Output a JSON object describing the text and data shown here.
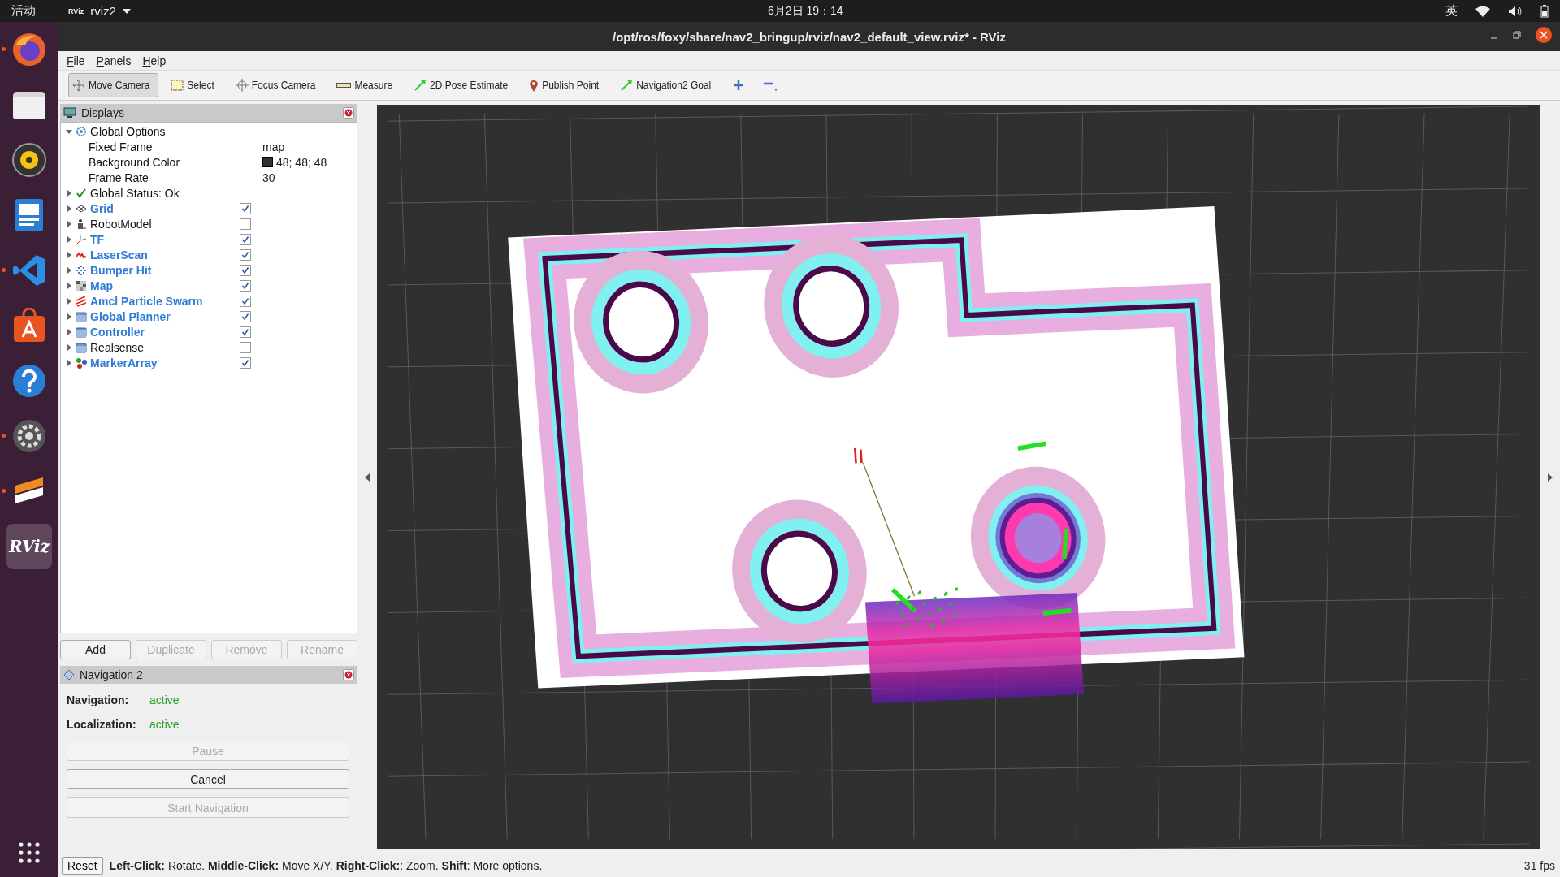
{
  "top_bar": {
    "activities": "活动",
    "app": {
      "logo": "RViz",
      "name": "rviz2"
    },
    "clock": "6月2日 19：14",
    "input_method": "英"
  },
  "window": {
    "title": "/opt/ros/foxy/share/nav2_bringup/rviz/nav2_default_view.rviz* - RViz"
  },
  "dock": [
    {
      "kind": "browser",
      "running": true,
      "selected": false
    },
    {
      "kind": "files",
      "running": false,
      "selected": false
    },
    {
      "kind": "music",
      "running": false,
      "selected": false
    },
    {
      "kind": "document",
      "running": false,
      "selected": false
    },
    {
      "kind": "code",
      "running": true,
      "selected": false
    },
    {
      "kind": "store",
      "running": false,
      "selected": false
    },
    {
      "kind": "help",
      "running": false,
      "selected": false
    },
    {
      "kind": "settings",
      "running": true,
      "selected": false
    },
    {
      "kind": "editor",
      "running": true,
      "selected": false
    },
    {
      "kind": "rviz",
      "label": "RViz",
      "running": false,
      "selected": true
    }
  ],
  "menu": [
    "File",
    "Panels",
    "Help"
  ],
  "toolbar": {
    "tools": [
      {
        "kind": "move",
        "label": "Move Camera",
        "selected": true
      },
      {
        "kind": "select",
        "label": "Select",
        "selected": false
      },
      {
        "kind": "focus",
        "label": "Focus Camera",
        "selected": false
      },
      {
        "kind": "measure",
        "label": "Measure",
        "selected": false
      },
      {
        "kind": "pose",
        "label": "2D Pose Estimate",
        "selected": false
      },
      {
        "kind": "point",
        "label": "Publish Point",
        "selected": false
      },
      {
        "kind": "pose",
        "label": "Navigation2 Goal",
        "selected": false
      }
    ]
  },
  "displays": {
    "title": "Displays",
    "items": [
      {
        "kind": "options",
        "label": "Global Options",
        "expanded": true,
        "children": [
          {
            "kind": "property",
            "label": "Fixed Frame",
            "value": "map"
          },
          {
            "kind": "color",
            "label": "Background Color",
            "value": "48; 48; 48",
            "color": "#303030"
          },
          {
            "kind": "property",
            "label": "Frame Rate",
            "value": "30"
          }
        ]
      },
      {
        "kind": "status",
        "label": "Global Status: Ok",
        "expanded": false
      },
      {
        "kind": "grid",
        "label": "Grid",
        "expanded": false,
        "checked": true
      },
      {
        "kind": "robot",
        "label": "RobotModel",
        "expanded": false,
        "checked": false
      },
      {
        "kind": "tf",
        "label": "TF",
        "expanded": false,
        "checked": true
      },
      {
        "kind": "laser",
        "label": "LaserScan",
        "expanded": false,
        "checked": true
      },
      {
        "kind": "bumper",
        "label": "Bumper Hit",
        "expanded": false,
        "checked": true
      },
      {
        "kind": "map",
        "label": "Map",
        "expanded": false,
        "checked": true
      },
      {
        "kind": "particles",
        "label": "Amcl Particle Swarm",
        "expanded": false,
        "checked": true
      },
      {
        "kind": "folder",
        "label": "Global Planner",
        "expanded": false,
        "checked": true
      },
      {
        "kind": "folder",
        "label": "Controller",
        "expanded": false,
        "checked": true
      },
      {
        "kind": "folder",
        "label": "Realsense",
        "expanded": false,
        "checked": false
      },
      {
        "kind": "markers",
        "label": "MarkerArray",
        "expanded": false,
        "checked": true
      }
    ]
  },
  "display_buttons": [
    {
      "label": "Add",
      "disabled": false
    },
    {
      "label": "Duplicate",
      "disabled": true
    },
    {
      "label": "Remove",
      "disabled": true
    },
    {
      "label": "Rename",
      "disabled": true
    }
  ],
  "navigation_panel": {
    "title": "Navigation 2",
    "fields": [
      {
        "label": "Navigation:",
        "value": "active"
      },
      {
        "label": "Localization:",
        "value": "active"
      }
    ],
    "buttons": [
      {
        "label": "Pause",
        "disabled": true
      },
      {
        "label": "Cancel",
        "disabled": false
      },
      {
        "label": "Start Navigation",
        "disabled": true
      }
    ]
  },
  "status_bar": {
    "reset": "Reset",
    "hint": "**Left-Click:** Rotate. **Middle-Click:** Move X/Y. **Right-Click:**: Zoom. **Shift**: More options.",
    "fps": "31 fps"
  }
}
